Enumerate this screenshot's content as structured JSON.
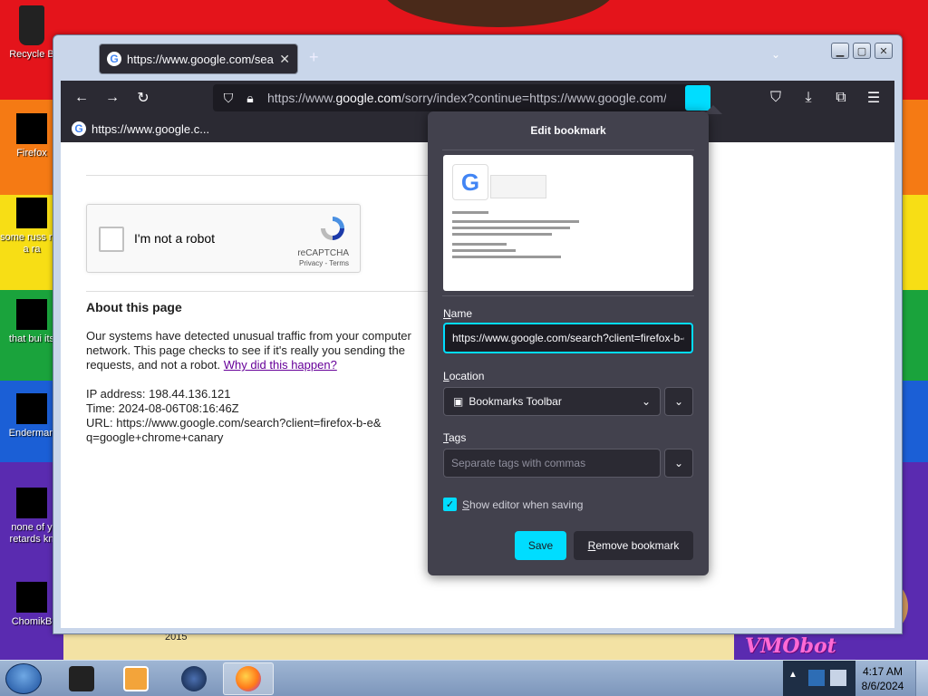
{
  "desktop": {
    "icons": [
      {
        "label": "Recycle B"
      },
      {
        "label": "Firefox"
      },
      {
        "label": "some russ ran a ra"
      },
      {
        "label": "that bui its"
      },
      {
        "label": "Enderman"
      },
      {
        "label": "none of y retards kn"
      },
      {
        "label": "ChomikB"
      }
    ],
    "caption_2015": "2015",
    "vm_label": "VMObot"
  },
  "browser": {
    "tab": {
      "title": "https://www.google.com/search?client=firefox-b-e&q=google+chrome+canary",
      "close": "✕"
    },
    "new_tab": "+",
    "url_host_prefix": "https://www.",
    "url_host": "google.com",
    "url_rest": "/sorry/index?continue=https://www.google.com/search",
    "bookmark_item": "https://www.google.c..."
  },
  "page": {
    "captcha": {
      "label": "I'm not a robot",
      "brand": "reCAPTCHA",
      "links": "Privacy - Terms"
    },
    "about_title": "About this page",
    "about_text": "Our systems have detected unusual traffic from your computer network. This page checks to see if it's really you sending the requests, and not a robot. ",
    "about_link": "Why did this happen?",
    "ip_line": "IP address: 198.44.136.121",
    "time_line": "Time: 2024-08-06T08:16:46Z",
    "url_line": "URL: https://www.google.com/search?client=firefox-b-e& q=google+chrome+canary"
  },
  "bookmark_panel": {
    "title": "Edit bookmark",
    "name_label_u": "N",
    "name_label_rest": "ame",
    "name_value": "https://www.google.com/search?client=firefox-b-e&q=google+chrome+canary",
    "location_label_u": "L",
    "location_label_rest": "ocation",
    "location_value": "Bookmarks Toolbar",
    "tags_label_u": "T",
    "tags_label_rest": "ags",
    "tags_placeholder": "Separate tags with commas",
    "show_editor_u": "S",
    "show_editor_rest": "how editor when saving",
    "show_editor_checked": true,
    "save_label": "Save",
    "remove_u": "R",
    "remove_rest": "emove bookmark"
  },
  "taskbar": {
    "time": "4:17 AM",
    "date": "8/6/2024"
  },
  "colors": {
    "accent": "#00ddff",
    "panel_bg": "#42414d",
    "toolbar_bg": "#2b2a33"
  }
}
